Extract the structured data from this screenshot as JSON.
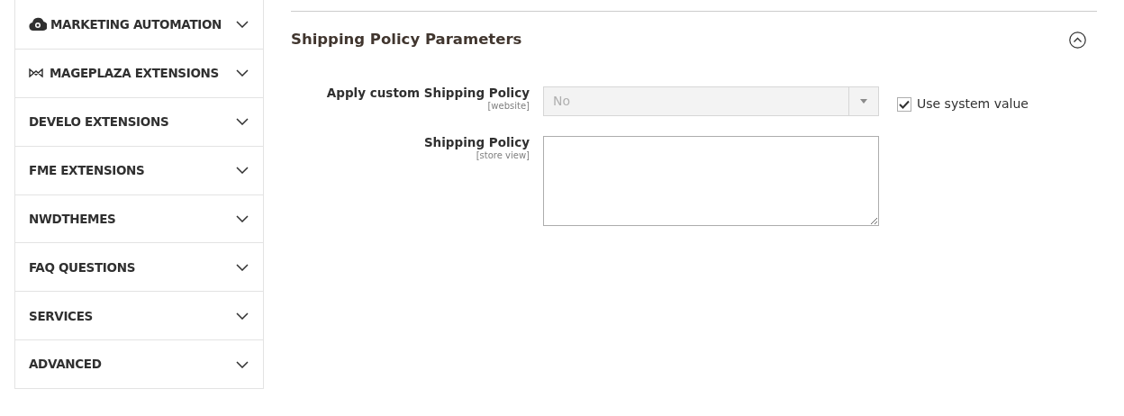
{
  "sidebar": {
    "items": [
      {
        "label": "MARKETING AUTOMATION",
        "kind": "cloud",
        "expanded": false
      },
      {
        "label": "MAGEPLAZA EXTENSIONS",
        "kind": "logo",
        "expanded": false
      },
      {
        "label": "DEVELO EXTENSIONS",
        "kind": "plain",
        "expanded": false
      },
      {
        "label": "FME EXTENSIONS",
        "kind": "plain",
        "expanded": false
      },
      {
        "label": "NWDTHEMES",
        "kind": "plain",
        "expanded": false
      },
      {
        "label": "FAQ QUESTIONS",
        "kind": "plain",
        "expanded": false
      },
      {
        "label": "SERVICES",
        "kind": "plain",
        "expanded": false
      },
      {
        "label": "ADVANCED",
        "kind": "plain",
        "expanded": false
      }
    ]
  },
  "section": {
    "title": "Shipping Policy Parameters",
    "expanded": true,
    "fields": [
      {
        "kind": "select",
        "label": "Apply custom Shipping Policy",
        "scope": "[website]",
        "value": "No",
        "disabled": true,
        "use_system_value": {
          "label": "Use system value",
          "checked": true
        }
      },
      {
        "kind": "textarea",
        "label": "Shipping Policy",
        "scope": "[store view]"
      }
    ]
  }
}
